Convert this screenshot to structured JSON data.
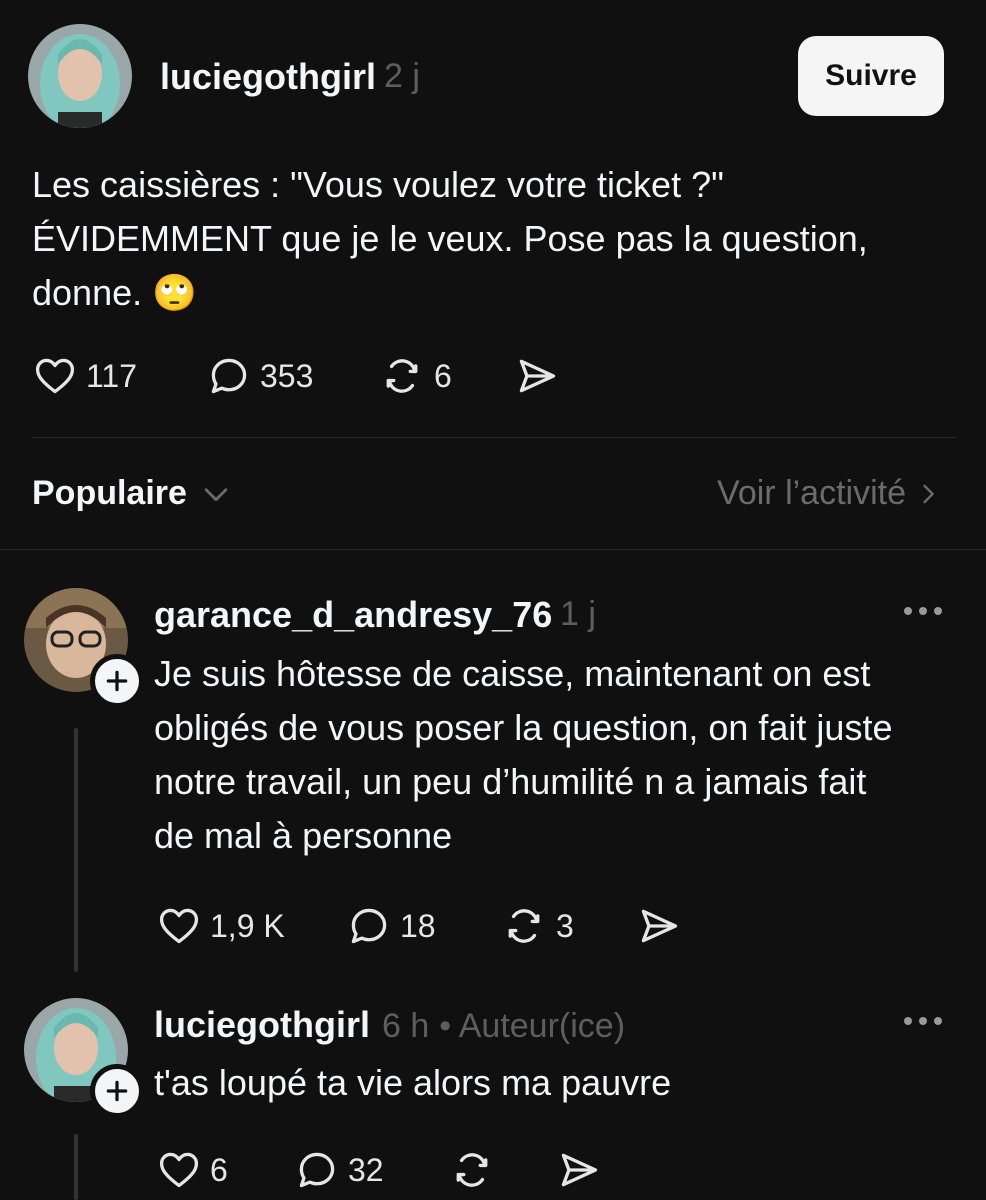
{
  "post": {
    "username": "luciegothgirl",
    "time": "2 j",
    "follow_label": "Suivre",
    "text_lines": [
      "Les caissières : \"Vous voulez votre ticket ?\"",
      "ÉVIDEMMENT que je le veux. Pose pas la question,",
      "donne."
    ],
    "emoji": "🙄",
    "likes": "117",
    "replies": "353",
    "reposts": "6"
  },
  "filter": {
    "sort_label": "Populaire",
    "activity_label": "Voir l’activité"
  },
  "replies": [
    {
      "username": "garance_d_andresy_76",
      "time": "1 j",
      "badge": "",
      "text_lines": [
        "Je suis hôtesse de caisse, maintenant on est",
        "obligés de vous poser la question, on fait juste",
        "notre travail, un peu d’humilité n a jamais fait",
        "de mal à personne"
      ],
      "likes": "1,9 K",
      "replies": "18",
      "reposts": "3"
    },
    {
      "username": "luciegothgirl",
      "time": "6 h",
      "badge": "• Auteur(ice)",
      "text_lines": [
        "t'as loupé ta vie alors ma pauvre"
      ],
      "likes": "6",
      "replies": "32",
      "reposts": ""
    }
  ],
  "icons": {
    "like": "heart-icon",
    "reply": "speech-bubble-icon",
    "repost": "repost-icon",
    "share": "send-icon",
    "more": "more-dots-icon",
    "follow_plus": "plus-icon",
    "sort": "chevron-down-icon",
    "activity": "chevron-right-icon"
  },
  "colors": {
    "background": "#101010",
    "text": "#f3f5f7",
    "muted": "#5e5e5e",
    "divider": "#2a2a2a",
    "button_bg": "#f5f5f5"
  }
}
